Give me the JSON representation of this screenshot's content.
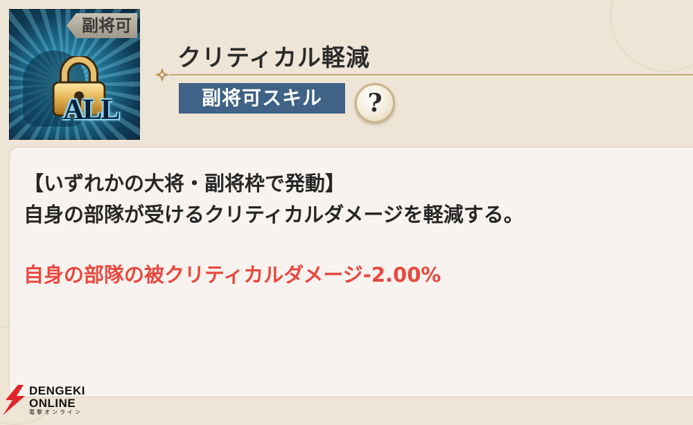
{
  "skill": {
    "icon_tag": "副将可",
    "icon_label": "ALL",
    "name": "クリティカル軽減",
    "type_badge": "副将可スキル",
    "help_symbol": "?"
  },
  "description": {
    "condition": "【いずれかの大将・副将枠で発動】",
    "text": "自身の部隊が受けるクリティカルダメージを軽減する。",
    "effect": "自身の部隊の被クリティカルダメージ-2.00%"
  },
  "watermark": {
    "line1": "DENGEKI",
    "line2": "ONLINE",
    "line3": "電撃オンライン"
  },
  "colors": {
    "badge_bg": "#3f6286",
    "effect_text": "#e8483f",
    "accent_gold": "#b8935a"
  },
  "icons": {
    "skill_icon": "padlock-icon",
    "help": "question-mark-icon",
    "divider_ornament": "fleur-ornament-icon",
    "watermark_logo": "dengeki-lightning-icon"
  }
}
